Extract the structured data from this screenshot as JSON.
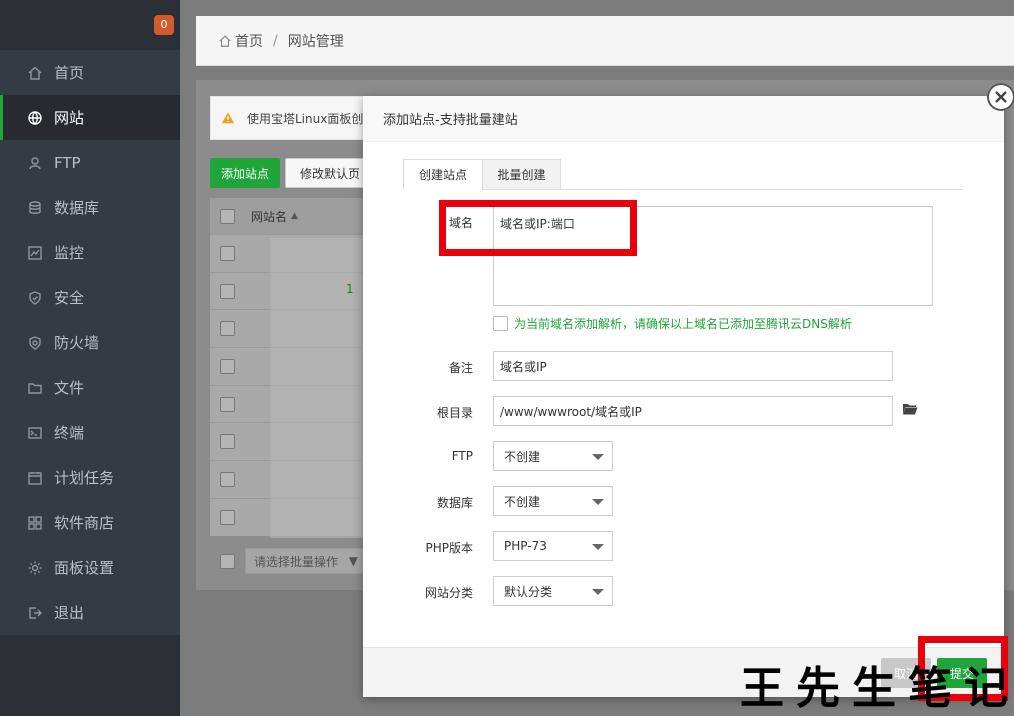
{
  "sidebar": {
    "badge": "0",
    "items": [
      {
        "label": "首页",
        "icon": "home-icon"
      },
      {
        "label": "网站",
        "icon": "globe-icon"
      },
      {
        "label": "FTP",
        "icon": "ftp-icon"
      },
      {
        "label": "数据库",
        "icon": "database-icon"
      },
      {
        "label": "监控",
        "icon": "monitor-icon"
      },
      {
        "label": "安全",
        "icon": "shield-icon"
      },
      {
        "label": "防火墙",
        "icon": "firewall-icon"
      },
      {
        "label": "文件",
        "icon": "folder-icon"
      },
      {
        "label": "终端",
        "icon": "terminal-icon"
      },
      {
        "label": "计划任务",
        "icon": "calendar-icon"
      },
      {
        "label": "软件商店",
        "icon": "grid-icon"
      },
      {
        "label": "面板设置",
        "icon": "gear-icon"
      },
      {
        "label": "退出",
        "icon": "logout-icon"
      }
    ],
    "active_index": 1
  },
  "breadcrumb": {
    "home": "首页",
    "current": "网站管理"
  },
  "site_panel": {
    "warning_text": "使用宝塔Linux面板创建",
    "add_site_label": "添加站点",
    "edit_default_label": "修改默认页",
    "table_header": "网站名",
    "row_number": "1",
    "batch_placeholder": "请选择批量操作"
  },
  "modal": {
    "title": "添加站点-支持批量建站",
    "tabs": [
      "创建站点",
      "批量创建"
    ],
    "domain_label": "域名",
    "domain_placeholder": "域名或IP:端口",
    "dns_checkbox_text": "为当前域名添加解析，请确保以上域名已添加至腾讯云DNS解析",
    "remark_label": "备注",
    "remark_value": "域名或IP",
    "root_label": "根目录",
    "root_value": "/www/wwwroot/域名或IP",
    "ftp_label": "FTP",
    "ftp_value": "不创建",
    "db_label": "数据库",
    "db_value": "不创建",
    "php_label": "PHP版本",
    "php_value": "PHP-73",
    "category_label": "网站分类",
    "category_value": "默认分类",
    "cancel_label": "取消",
    "submit_label": "提交"
  },
  "watermark": "王先生笔记",
  "colors": {
    "accent": "#20a53a",
    "highlight": "#e8000b",
    "sidebar": "#353b43"
  }
}
